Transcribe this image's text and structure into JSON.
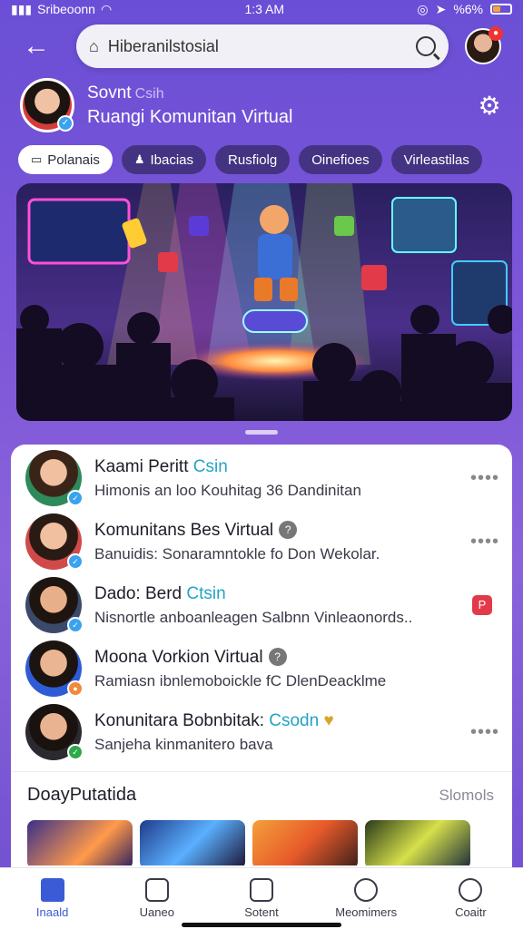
{
  "status_bar": {
    "carrier": "Sribeoonn",
    "time": "1:3 AM",
    "battery": "%6%"
  },
  "search": {
    "url": "Hiberanilstosial"
  },
  "profile": {
    "name": "Sovnt",
    "tag": "Csih",
    "subtitle": "Ruangi Komunitan Virtual"
  },
  "chips": [
    {
      "label": "Polanais",
      "active": true
    },
    {
      "label": "Ibacias",
      "active": false
    },
    {
      "label": "Rusfiolg",
      "active": false
    },
    {
      "label": "Oinefioes",
      "active": false
    },
    {
      "label": "Virleastilas",
      "active": false
    }
  ],
  "list": [
    {
      "title": "Kaami Peritt",
      "accent": "Csin",
      "subtitle": "Himonis an loo Kouhitag 36 Dandinitan",
      "action": "more"
    },
    {
      "title": "Komunitans Bes Virtual",
      "accent": "",
      "subtitle": "Banuidis: Sonaramntokle fo Don Wekolar.",
      "action": "more"
    },
    {
      "title": "Dado: Berd",
      "accent": "Ctsin",
      "subtitle": "Nisnortle anboanleagen Salbnn Vinleaonords..",
      "action": "flag"
    },
    {
      "title": "Moona Vorkion Virtual",
      "accent": "",
      "subtitle": "Ramiasn ibnlemoboickle fC DlenDeacklme",
      "action": "none"
    },
    {
      "title": "Konunitara Bobnbitak:",
      "accent": "Csodn",
      "subtitle": "Sanjeha kinmanitero bava",
      "action": "more"
    }
  ],
  "section": {
    "title": "DoayPutatida",
    "link": "Slomols"
  },
  "nav": [
    {
      "label": "Inaald",
      "active": true
    },
    {
      "label": "Uaneo",
      "active": false
    },
    {
      "label": "Sotent",
      "active": false
    },
    {
      "label": "Meomimers",
      "active": false
    },
    {
      "label": "Coaitr",
      "active": false
    }
  ],
  "colors": {
    "accent": "#22a4c4",
    "nav_active": "#3b5bd6",
    "background": "#7d56d8"
  }
}
